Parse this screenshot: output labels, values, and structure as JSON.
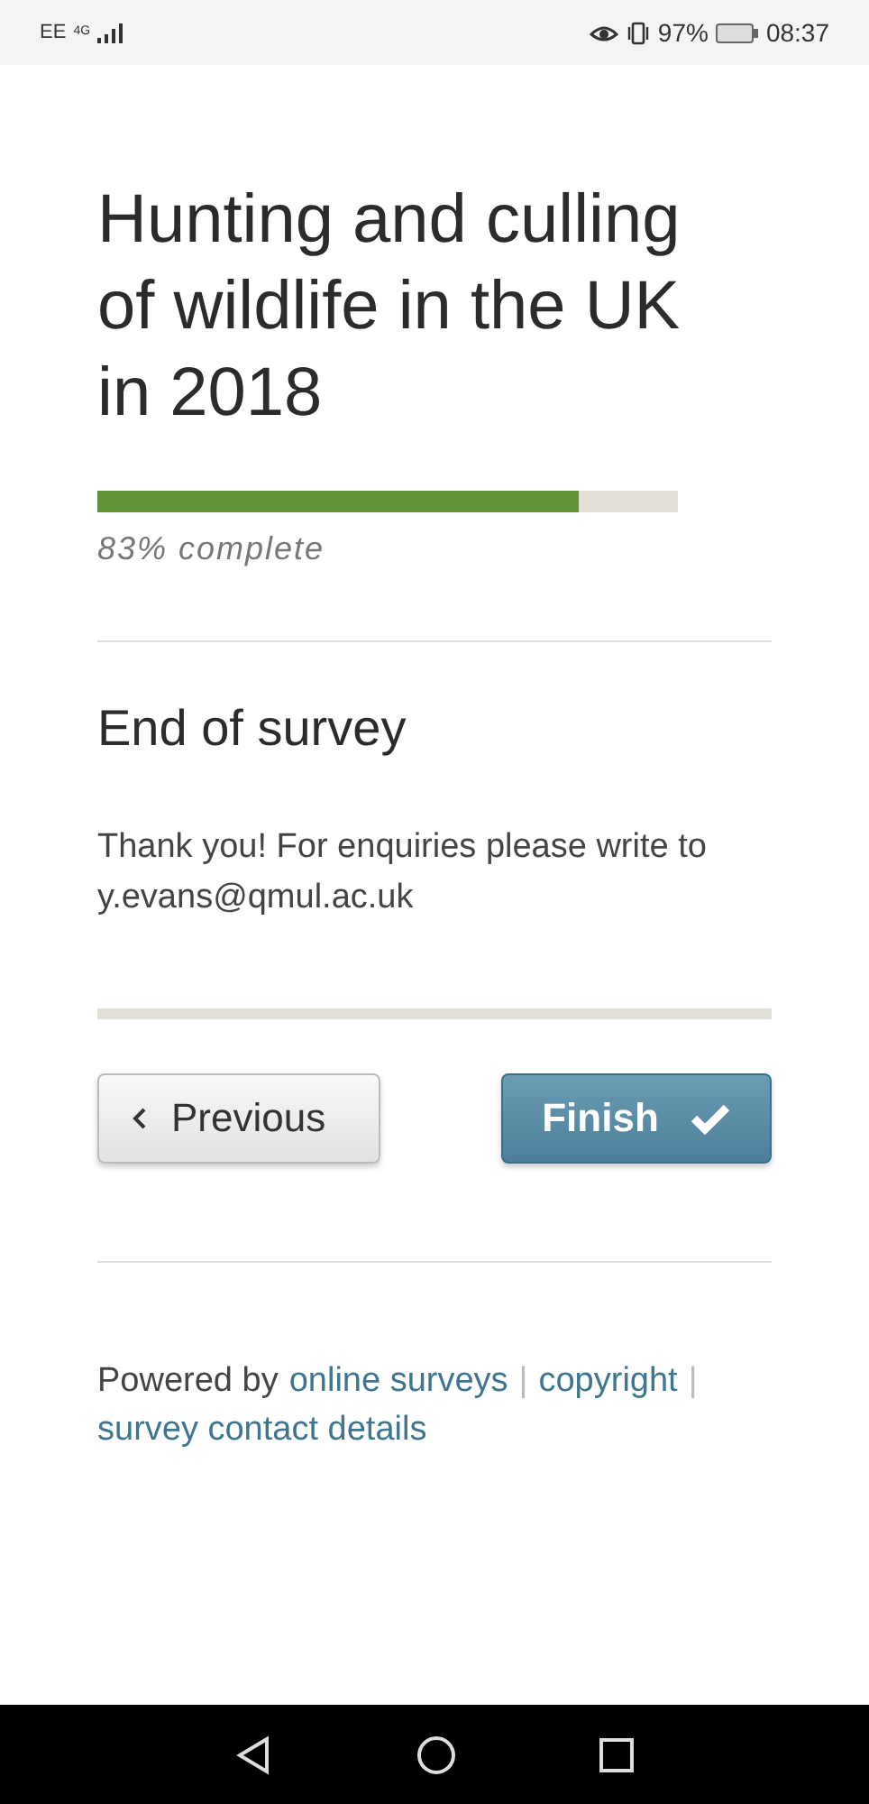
{
  "status_bar": {
    "carrier": "EE",
    "network": "4G",
    "battery": "97%",
    "time": "08:37"
  },
  "survey": {
    "title": "Hunting and culling of wildlife in the UK in 2018",
    "progress": {
      "level": 0.83,
      "label": "83% complete"
    }
  },
  "section": {
    "heading": "End of survey",
    "message": "Thank you! For enquiries please write to y.evans@qmul.ac.uk"
  },
  "buttons": [
    {
      "kind": "previous",
      "label": "Previous"
    },
    {
      "kind": "finish",
      "label": "Finish"
    }
  ],
  "footer": {
    "prefix": "Powered by",
    "links": [
      "online surveys",
      "copyright",
      "survey contact details"
    ],
    "separator": "|"
  }
}
